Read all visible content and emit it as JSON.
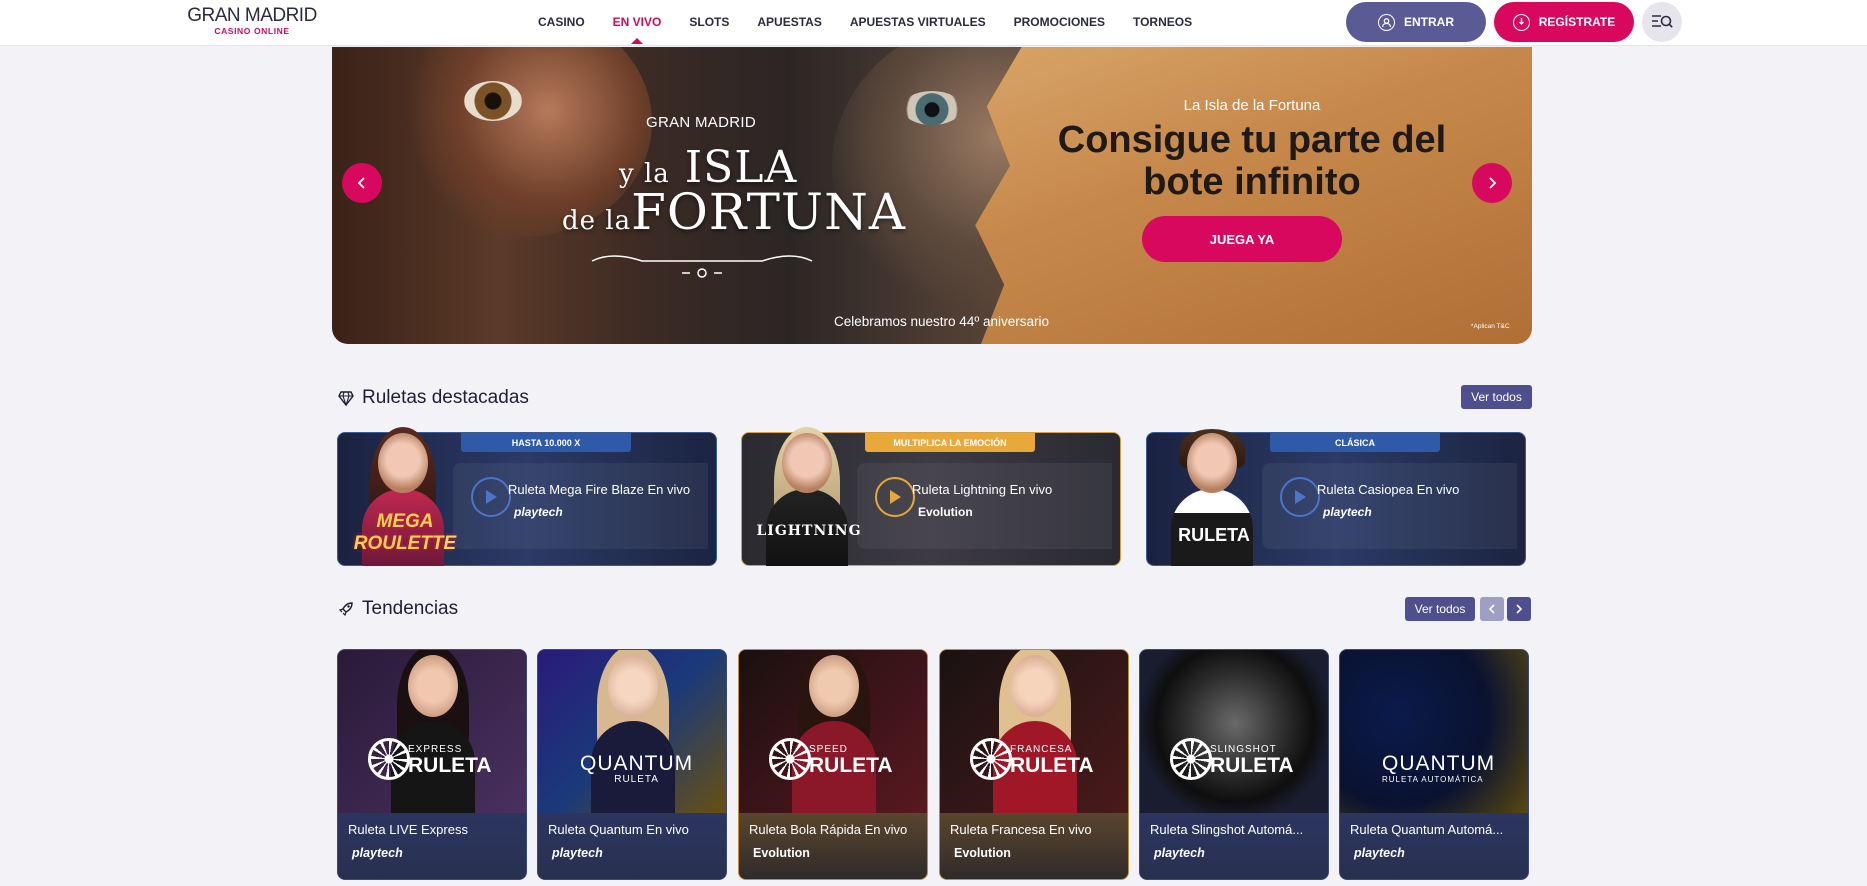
{
  "header": {
    "logo_main": "GRAN MADRID",
    "logo_sub": "CASINO ONLINE",
    "nav": [
      "CASINO",
      "EN VIVO",
      "SLOTS",
      "APUESTAS",
      "APUESTAS VIRTUALES",
      "PROMOCIONES",
      "TORNEOS"
    ],
    "nav_active": "EN VIVO",
    "login_label": "ENTRAR",
    "register_label": "REGÍSTRATE"
  },
  "banner": {
    "brand": "GRAN MADRID",
    "title_line1_small": "y la",
    "title_line1_big": "ISLA",
    "title_line2_small": "de la",
    "title_line2_big": "FORTUNA",
    "anniversary": "Celebramos nuestro 44º aniversario",
    "kicker": "La Isla de la Fortuna",
    "headline": "Consigue tu parte del bote infinito",
    "cta": "JUEGA YA",
    "terms": "*Aplican T&C"
  },
  "featured": {
    "title": "Ruletas destacadas",
    "view_all": "Ver todos",
    "cards": [
      {
        "tag": "HASTA 10.000 X",
        "name": "Ruleta Mega Fire Blaze En vivo",
        "provider": "playtech",
        "logo": "MEGA ROULETTE"
      },
      {
        "tag": "MULTIPLICA LA EMOCIÓN",
        "name": "Ruleta Lightning En vivo",
        "provider": "Evolution",
        "logo": "LIGHTNING"
      },
      {
        "tag": "CLÁSICA",
        "name": "Ruleta Casiopea En vivo",
        "provider": "playtech",
        "logo": "RULETA"
      }
    ]
  },
  "trending": {
    "title": "Tendencias",
    "view_all": "Ver todos",
    "cards": [
      {
        "name": "Ruleta LIVE Express",
        "provider": "playtech",
        "logo_small": "EXPRESS",
        "logo_big": "RULETA"
      },
      {
        "name": "Ruleta Quantum En vivo",
        "provider": "playtech",
        "logo_small": "RULETA",
        "logo_big": "QUANTUM"
      },
      {
        "name": "Ruleta Bola Rápida En vivo",
        "provider": "Evolution",
        "logo_small": "SPEED",
        "logo_big": "RULETA"
      },
      {
        "name": "Ruleta Francesa En vivo",
        "provider": "Evolution",
        "logo_small": "FRANCESA",
        "logo_big": "RULETA"
      },
      {
        "name": "Ruleta Slingshot Automá...",
        "provider": "playtech",
        "logo_small": "SLINGSHOT",
        "logo_big": "RULETA"
      },
      {
        "name": "Ruleta Quantum Automá...",
        "provider": "playtech",
        "logo_small": "RULETA AUTOMÁTICA",
        "logo_big": "QUANTUM"
      }
    ]
  },
  "colors": {
    "brand_pink": "#d8085f",
    "brand_purple": "#5a5a95",
    "background": "#f3f2f7"
  }
}
